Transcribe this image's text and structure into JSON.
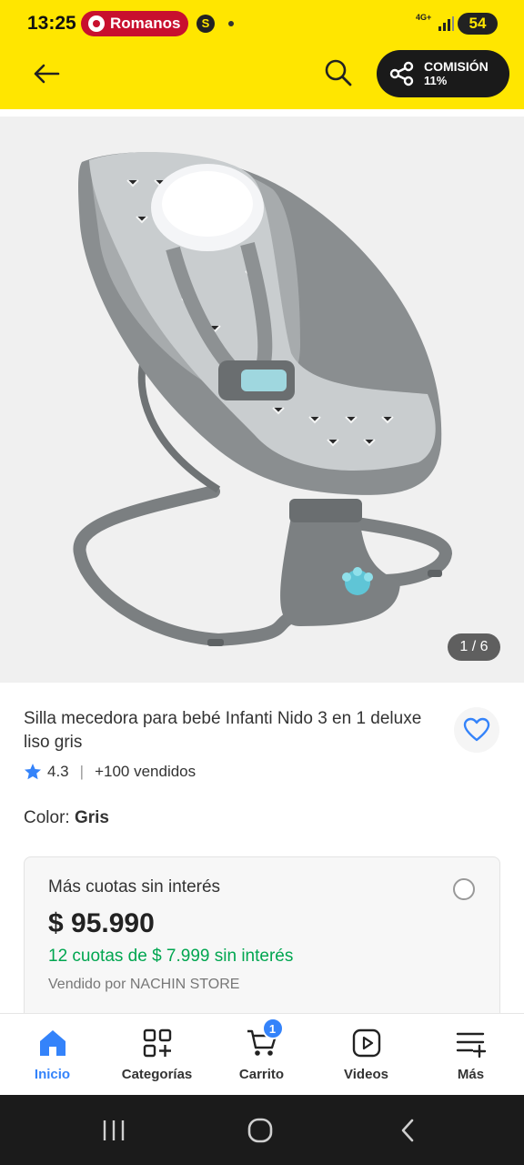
{
  "status_bar": {
    "time": "13:25",
    "notification_pill": "Romanos",
    "app_icon": "S",
    "network": "4G+",
    "battery": "54"
  },
  "header": {
    "back_icon": "arrow-left-icon",
    "search_icon": "search-icon",
    "commission_label": "COMISIÓN",
    "commission_value": "11%"
  },
  "gallery": {
    "counter": "1 / 6"
  },
  "product": {
    "title": "Silla mecedora para bebé Infanti Nido 3 en 1 deluxe liso gris",
    "rating": "4.3",
    "sold": "+100 vendidos",
    "color_label": "Color: ",
    "color_value": "Gris"
  },
  "payment_option": {
    "heading": "Más cuotas sin interés",
    "price": "$ 95.990",
    "installments": "12 cuotas de $ 7.999 sin interés",
    "seller": "Vendido por NACHIN STORE"
  },
  "bottom_nav": {
    "items": [
      {
        "label": "Inicio",
        "icon": "home-icon"
      },
      {
        "label": "Categorías",
        "icon": "categories-icon"
      },
      {
        "label": "Carrito",
        "icon": "cart-icon",
        "badge": "1"
      },
      {
        "label": "Videos",
        "icon": "video-icon"
      },
      {
        "label": "Más",
        "icon": "more-icon"
      }
    ]
  },
  "colors": {
    "brand_yellow": "#ffe600",
    "accent_blue": "#3483fa",
    "success_green": "#00a650"
  }
}
